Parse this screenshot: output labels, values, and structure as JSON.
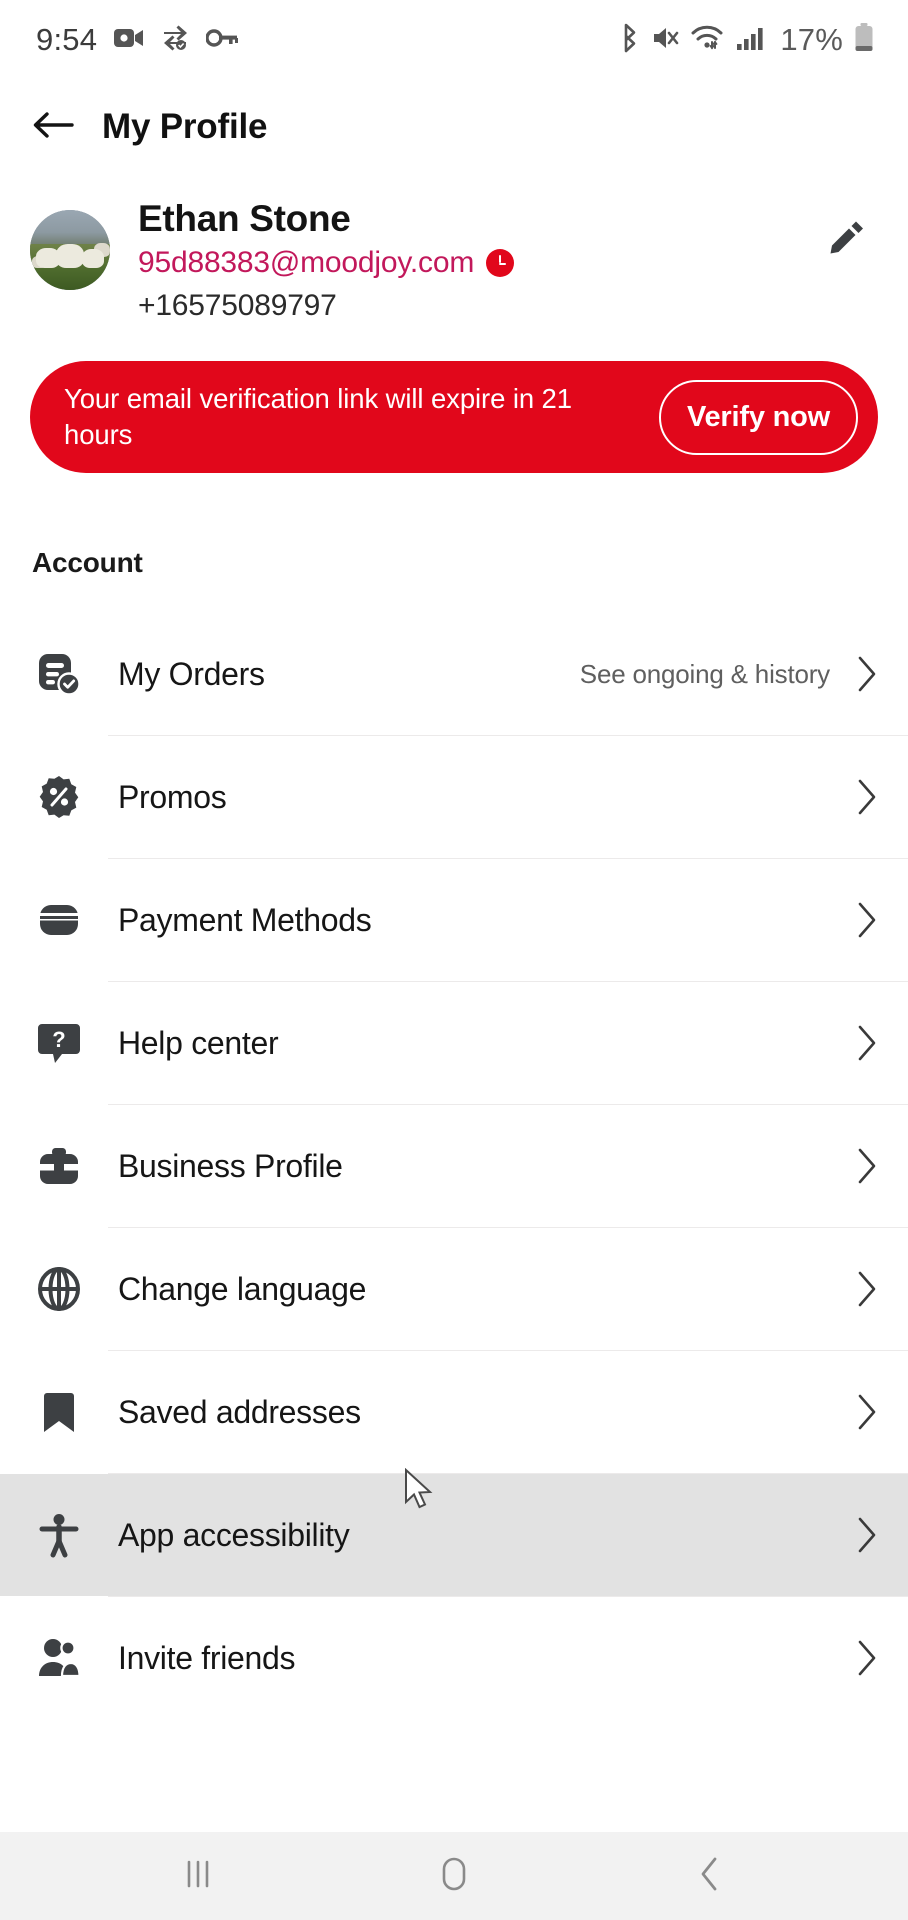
{
  "status_bar": {
    "time": "9:54",
    "battery_percent": "17%",
    "left_icons": [
      "video-camera-icon",
      "transfer-icon",
      "key-icon"
    ],
    "right_icons": [
      "bluetooth-icon",
      "mute-icon",
      "wifi-icon",
      "signal-icon",
      "battery-icon"
    ]
  },
  "header": {
    "title": "My Profile",
    "back_icon": "back-arrow-icon"
  },
  "profile": {
    "name": "Ethan Stone",
    "email": "95d88383@moodjoy.com",
    "email_status_icon": "pending-clock-badge",
    "phone": "+16575089797",
    "avatar_alt": "sheep-grazing-photo",
    "edit_icon": "pencil-icon"
  },
  "banner": {
    "message": "Your email verification link will expire in 21 hours",
    "action_label": "Verify now",
    "background_color": "#e1071b",
    "text_color": "#ffffff"
  },
  "account": {
    "section_label": "Account",
    "items": [
      {
        "label": "My Orders",
        "sub": "See ongoing & history",
        "icon": "orders-icon",
        "pressed": false
      },
      {
        "label": "Promos",
        "sub": "",
        "icon": "discount-icon",
        "pressed": false
      },
      {
        "label": "Payment Methods",
        "sub": "",
        "icon": "credit-card-icon",
        "pressed": false
      },
      {
        "label": "Help center",
        "sub": "",
        "icon": "question-icon",
        "pressed": false
      },
      {
        "label": "Business Profile",
        "sub": "",
        "icon": "briefcase-icon",
        "pressed": false
      },
      {
        "label": "Change language",
        "sub": "",
        "icon": "globe-icon",
        "pressed": false
      },
      {
        "label": "Saved addresses",
        "sub": "",
        "icon": "bookmark-icon",
        "pressed": false
      },
      {
        "label": "App accessibility",
        "sub": "",
        "icon": "accessibility-icon",
        "pressed": true
      },
      {
        "label": "Invite friends",
        "sub": "",
        "icon": "people-icon",
        "pressed": false
      }
    ]
  },
  "nav_bar": {
    "recents_icon": "recents-icon",
    "home_icon": "home-icon",
    "back_icon": "nav-back-icon"
  },
  "colors": {
    "accent_red": "#e1071b",
    "email_pink": "#c2185b",
    "pressed_grey": "#e2e2e2"
  }
}
